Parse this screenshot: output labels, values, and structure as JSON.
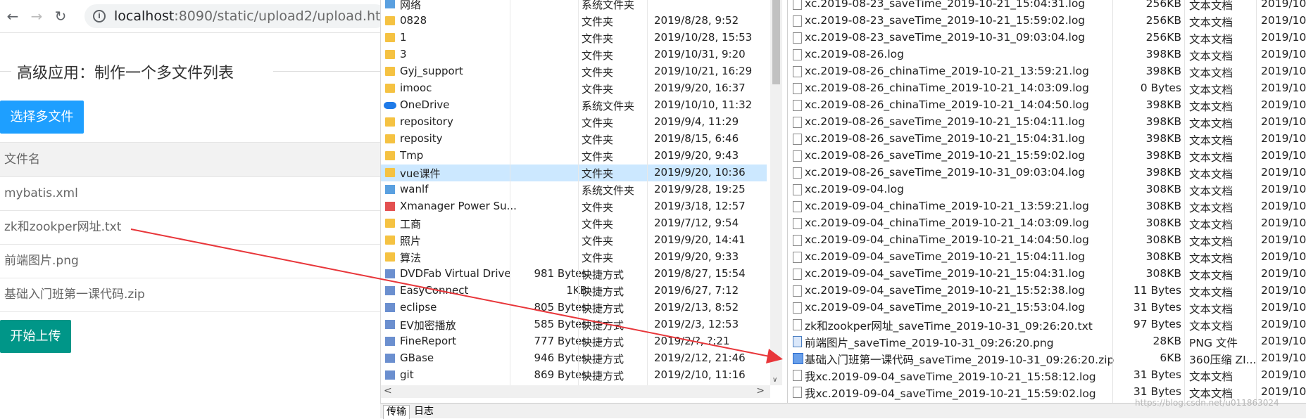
{
  "browser": {
    "back_icon": "←",
    "forward_icon": "→",
    "reload_icon": "↻",
    "url_host": "localhost",
    "url_path": ":8090/static/upload2/upload.html",
    "legend_title": "高级应用：制作一个多文件列表",
    "select_button": "选择多文件",
    "table_header": "文件名",
    "files": [
      "mybatis.xml",
      "zk和zookper网址.txt",
      "前端图片.png",
      "基础入门班第一课代码.zip"
    ],
    "upload_button": "开始上传"
  },
  "left_pane": {
    "rows": [
      {
        "name": "网络",
        "size": "",
        "type": "系统文件夹",
        "date": "",
        "icon": "network-icon"
      },
      {
        "name": "0828",
        "size": "",
        "type": "文件夹",
        "date": "2019/8/28, 9:52",
        "icon": "folder-icon"
      },
      {
        "name": "1",
        "size": "",
        "type": "文件夹",
        "date": "2019/10/28, 15:53",
        "icon": "folder-icon"
      },
      {
        "name": "3",
        "size": "",
        "type": "文件夹",
        "date": "2019/10/31, 9:20",
        "icon": "folder-icon"
      },
      {
        "name": "Gyj_support",
        "size": "",
        "type": "文件夹",
        "date": "2019/10/21, 16:29",
        "icon": "folder-icon"
      },
      {
        "name": "imooc",
        "size": "",
        "type": "文件夹",
        "date": "2019/9/20, 16:37",
        "icon": "folder-icon"
      },
      {
        "name": "OneDrive",
        "size": "",
        "type": "系统文件夹",
        "date": "2019/10/10, 11:32",
        "icon": "onedrive-icon"
      },
      {
        "name": "repository",
        "size": "",
        "type": "文件夹",
        "date": "2019/9/4, 11:29",
        "icon": "folder-icon"
      },
      {
        "name": "reposity",
        "size": "",
        "type": "文件夹",
        "date": "2019/8/15, 6:46",
        "icon": "folder-icon"
      },
      {
        "name": "Tmp",
        "size": "",
        "type": "文件夹",
        "date": "2019/9/20, 9:43",
        "icon": "folder-icon"
      },
      {
        "name": "vue课件",
        "size": "",
        "type": "文件夹",
        "date": "2019/9/20, 10:36",
        "icon": "folder-icon",
        "selected": true
      },
      {
        "name": "wanlf",
        "size": "",
        "type": "系统文件夹",
        "date": "2019/9/28, 19:25",
        "icon": "user-folder-icon"
      },
      {
        "name": "Xmanager Power Su...",
        "size": "",
        "type": "文件夹",
        "date": "2019/3/18, 12:57",
        "icon": "xmanager-icon"
      },
      {
        "name": "工商",
        "size": "",
        "type": "文件夹",
        "date": "2019/7/12, 9:54",
        "icon": "folder-icon"
      },
      {
        "name": "照片",
        "size": "",
        "type": "文件夹",
        "date": "2019/9/20, 14:41",
        "icon": "folder-icon"
      },
      {
        "name": "算法",
        "size": "",
        "type": "文件夹",
        "date": "2019/9/20, 9:33",
        "icon": "folder-icon"
      },
      {
        "name": "DVDFab Virtual Drive",
        "size": "981 Bytes",
        "type": "快捷方式",
        "date": "2019/8/27, 15:54",
        "icon": "dvdfab-icon"
      },
      {
        "name": "EasyConnect",
        "size": "1KB",
        "type": "快捷方式",
        "date": "2019/6/27, 7:12",
        "icon": "easyconnect-icon"
      },
      {
        "name": "eclipse",
        "size": "805 Bytes",
        "type": "快捷方式",
        "date": "2019/2/13, 8:52",
        "icon": "eclipse-icon"
      },
      {
        "name": "EV加密播放",
        "size": "585 Bytes",
        "type": "快捷方式",
        "date": "2019/2/3, 12:53",
        "icon": "ev-icon"
      },
      {
        "name": "FineReport",
        "size": "777 Bytes",
        "type": "快捷方式",
        "date": "2019/2/?, ?:21",
        "icon": "finereport-icon"
      },
      {
        "name": "GBase",
        "size": "946 Bytes",
        "type": "快捷方式",
        "date": "2019/2/12, 21:46",
        "icon": "gbase-icon"
      },
      {
        "name": "git",
        "size": "869 Bytes",
        "type": "快捷方式",
        "date": "2019/2/10, 11:16",
        "icon": "git-icon"
      }
    ],
    "hscroll_left": "<",
    "hscroll_right": ">",
    "vscroll_down": "∨"
  },
  "right_pane": {
    "rows": [
      {
        "name": "xc.2019-08-23_saveTime_2019-10-21_15:04:31.log",
        "size": "256KB",
        "type": "文本文档",
        "date": "2019/10/"
      },
      {
        "name": "xc.2019-08-23_saveTime_2019-10-21_15:59:02.log",
        "size": "256KB",
        "type": "文本文档",
        "date": "2019/10/"
      },
      {
        "name": "xc.2019-08-23_saveTime_2019-10-31_09:03:04.log",
        "size": "256KB",
        "type": "文本文档",
        "date": "2019/10/"
      },
      {
        "name": "xc.2019-08-26.log",
        "size": "398KB",
        "type": "文本文档",
        "date": "2019/10/"
      },
      {
        "name": "xc.2019-08-26_chinaTime_2019-10-21_13:59:21.log",
        "size": "398KB",
        "type": "文本文档",
        "date": "2019/10/"
      },
      {
        "name": "xc.2019-08-26_chinaTime_2019-10-21_14:03:09.log",
        "size": "0 Bytes",
        "type": "文本文档",
        "date": "2019/10/"
      },
      {
        "name": "xc.2019-08-26_chinaTime_2019-10-21_14:04:50.log",
        "size": "398KB",
        "type": "文本文档",
        "date": "2019/10/"
      },
      {
        "name": "xc.2019-08-26_saveTime_2019-10-21_15:04:11.log",
        "size": "398KB",
        "type": "文本文档",
        "date": "2019/10/"
      },
      {
        "name": "xc.2019-08-26_saveTime_2019-10-21_15:04:31.log",
        "size": "398KB",
        "type": "文本文档",
        "date": "2019/10/"
      },
      {
        "name": "xc.2019-08-26_saveTime_2019-10-21_15:59:02.log",
        "size": "398KB",
        "type": "文本文档",
        "date": "2019/10/"
      },
      {
        "name": "xc.2019-08-26_saveTime_2019-10-31_09:03:04.log",
        "size": "398KB",
        "type": "文本文档",
        "date": "2019/10/"
      },
      {
        "name": "xc.2019-09-04.log",
        "size": "308KB",
        "type": "文本文档",
        "date": "2019/10/"
      },
      {
        "name": "xc.2019-09-04_chinaTime_2019-10-21_13:59:21.log",
        "size": "308KB",
        "type": "文本文档",
        "date": "2019/10/"
      },
      {
        "name": "xc.2019-09-04_chinaTime_2019-10-21_14:03:09.log",
        "size": "308KB",
        "type": "文本文档",
        "date": "2019/10/"
      },
      {
        "name": "xc.2019-09-04_chinaTime_2019-10-21_14:04:50.log",
        "size": "308KB",
        "type": "文本文档",
        "date": "2019/10/"
      },
      {
        "name": "xc.2019-09-04_saveTime_2019-10-21_15:04:11.log",
        "size": "308KB",
        "type": "文本文档",
        "date": "2019/10/"
      },
      {
        "name": "xc.2019-09-04_saveTime_2019-10-21_15:04:31.log",
        "size": "308KB",
        "type": "文本文档",
        "date": "2019/10/"
      },
      {
        "name": "xc.2019-09-04_saveTime_2019-10-21_15:52:38.log",
        "size": "11 Bytes",
        "type": "文本文档",
        "date": "2019/10/"
      },
      {
        "name": "xc.2019-09-04_saveTime_2019-10-21_15:53:04.log",
        "size": "31 Bytes",
        "type": "文本文档",
        "date": "2019/10/"
      },
      {
        "name": "zk和zookper网址_saveTime_2019-10-31_09:26:20.txt",
        "size": "97 Bytes",
        "type": "文本文档",
        "date": "2019/10/"
      },
      {
        "name": "前端图片_saveTime_2019-10-31_09:26:20.png",
        "size": "28KB",
        "type": "PNG 文件",
        "date": "2019/10/",
        "icon": "png"
      },
      {
        "name": "基础入门班第一课代码_saveTime_2019-10-31_09:26:20.zip",
        "size": "6KB",
        "type": "360压缩 ZI...",
        "date": "2019/10/",
        "icon": "zip"
      },
      {
        "name": "我xc.2019-09-04_saveTime_2019-10-21_15:58:12.log",
        "size": "31 Bytes",
        "type": "文本文档",
        "date": "2019/10/"
      },
      {
        "name": "我xc.2019-09-04_saveTime_2019-10-21_15:59:02.log",
        "size": "31 Bytes",
        "type": "文本文档",
        "date": "2019/10/"
      }
    ]
  },
  "statusbar": {
    "tab_transfer": "传输",
    "tab_log": "日志"
  },
  "watermark": "https://blog.csdn.net/u011863024",
  "colors": {
    "primary_button": "#1e9fff",
    "upload_button": "#009688",
    "selected_row": "#cce8ff",
    "arrow": "#e8363a"
  }
}
